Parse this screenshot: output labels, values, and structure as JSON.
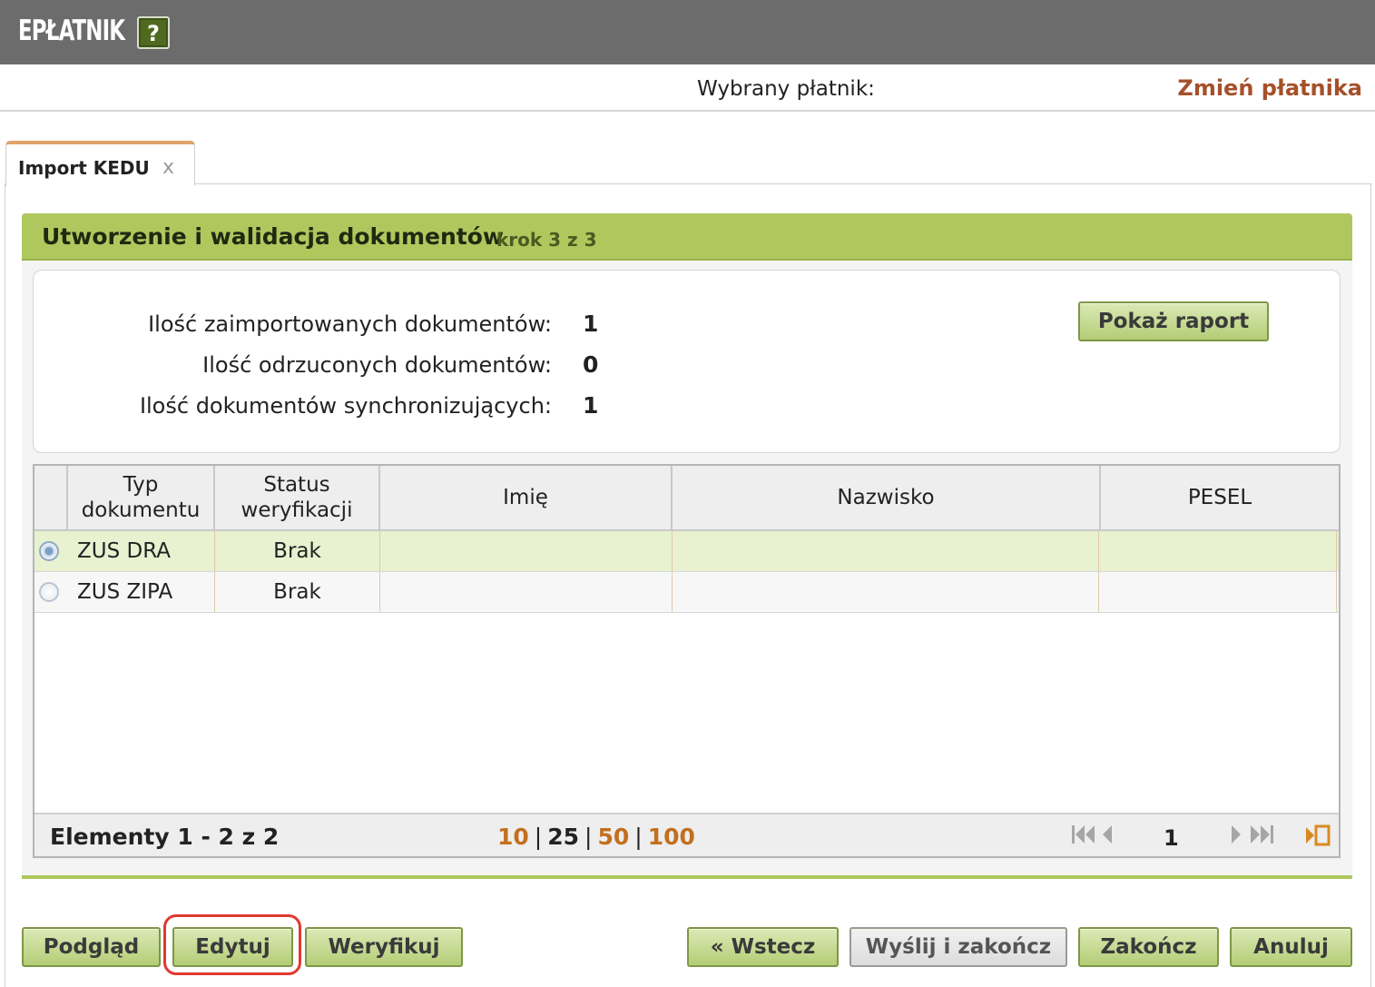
{
  "header": {
    "app_title": "EPŁATNIK",
    "help_label": "?"
  },
  "payer": {
    "label": "Wybrany płatnik:",
    "change_link": "Zmień płatnika"
  },
  "tab": {
    "label": "Import KEDU",
    "close_icon": "x"
  },
  "panel": {
    "title": "Utworzenie i walidacja dokumentów",
    "step": "krok 3 z 3"
  },
  "summary": {
    "rows": [
      {
        "label": "Ilość zaimportowanych dokumentów:",
        "value": "1"
      },
      {
        "label": "Ilość odrzuconych dokumentów:",
        "value": "0"
      },
      {
        "label": "Ilość dokumentów synchronizujących:",
        "value": "1"
      }
    ],
    "report_button": "Pokaż raport"
  },
  "grid": {
    "columns": [
      "Typ dokumentu",
      "Status weryfikacji",
      "Imię",
      "Nazwisko",
      "PESEL"
    ],
    "rows": [
      {
        "selected": true,
        "type": "ZUS DRA",
        "status": "Brak",
        "first_name": "",
        "last_name": "",
        "pesel": ""
      },
      {
        "selected": false,
        "type": "ZUS ZIPA",
        "status": "Brak",
        "first_name": "",
        "last_name": "",
        "pesel": ""
      }
    ],
    "footer": {
      "items_count": "Elementy 1 - 2 z 2",
      "page_sizes": [
        "10",
        "25",
        "50",
        "100"
      ],
      "current_page_size": "25",
      "current_page": "1",
      "first_icon": "first-page-icon",
      "prev_icon": "prev-page-icon",
      "next_icon": "next-page-icon",
      "last_icon": "last-page-icon",
      "export_icon": "export-icon"
    }
  },
  "actions": {
    "preview": "Podgląd",
    "edit": "Edytuj",
    "verify": "Weryfikuj",
    "back": "« Wstecz",
    "send_finish": "Wyślij i zakończ",
    "finish": "Zakończ",
    "cancel": "Anuluj"
  },
  "colors": {
    "topbar": "#6b6c6b",
    "accent_green": "#afc85e",
    "link_orange": "#a5502a",
    "highlight_ring": "#e0392f"
  }
}
